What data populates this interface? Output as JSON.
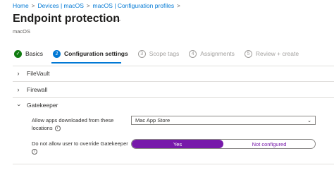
{
  "breadcrumb": {
    "items": [
      "Home",
      "Devices | macOS",
      "macOS | Configuration profiles"
    ],
    "separator": ">"
  },
  "page": {
    "title": "Endpoint protection",
    "more": "···",
    "subtitle": "macOS"
  },
  "wizard": {
    "steps": [
      {
        "num": "✓",
        "label": "Basics",
        "state": "done"
      },
      {
        "num": "2",
        "label": "Configuration settings",
        "state": "current"
      },
      {
        "num": "3",
        "label": "Scope tags",
        "state": "future"
      },
      {
        "num": "4",
        "label": "Assignments",
        "state": "future"
      },
      {
        "num": "5",
        "label": "Review + create",
        "state": "future"
      }
    ]
  },
  "sections": {
    "filevault": {
      "label": "FileVault",
      "chevron": "›"
    },
    "firewall": {
      "label": "Firewall",
      "chevron": "›"
    },
    "gatekeeper": {
      "label": "Gatekeeper",
      "chevron": "‹"
    }
  },
  "gatekeeper": {
    "allow_apps": {
      "label_line1": "Allow apps downloaded from these",
      "label_line2": "locations",
      "value": "Mac App Store"
    },
    "override": {
      "label": "Do not allow user to override Gatekeeper",
      "options": [
        "Yes",
        "Not configured"
      ],
      "selected": "Yes"
    }
  },
  "icons": {
    "info": "i",
    "caret": "⌄"
  },
  "colors": {
    "link": "#0078d4",
    "done": "#107c10",
    "toggle_on": "#7719aa"
  }
}
